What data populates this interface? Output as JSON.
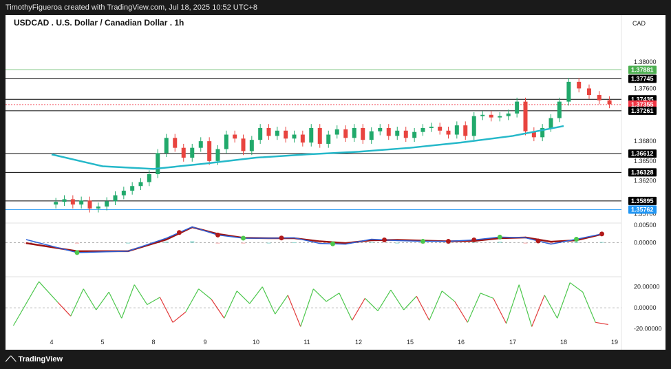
{
  "header": {
    "attribution": "TimothyFigueroa created with TradingView.com, Jul 18, 2025 10:52 UTC+8"
  },
  "footer": {
    "brand": "TradingView"
  },
  "colors": {
    "candle_up": "#21a96b",
    "candle_down": "#e8443f",
    "ma": "#25b8c9",
    "macd_line": "#2c62d8",
    "signal_line": "#9c1414",
    "osc_up": "#4cc74c",
    "osc_down": "#e23b3b",
    "tag_green": "#4caf50",
    "tag_red": "#f23645",
    "tag_blue": "#2196f3",
    "tag_black": "#000000"
  },
  "chart_data": [
    {
      "type": "candlestick",
      "title": "USDCAD . U.S. Dollar / Canadian Dollar . 1h",
      "currency": "CAD",
      "y_ticks": [
        "1.38000",
        "1.37600",
        "1.36800",
        "1.36500",
        "1.36200",
        "1.35900",
        "1.35700"
      ],
      "y_tick_values": [
        1.38,
        1.376,
        1.368,
        1.365,
        1.362,
        1.359,
        1.357
      ],
      "ylim": [
        1.3558,
        1.3821
      ],
      "x_ticks": [
        "4",
        "5",
        "8",
        "9",
        "10",
        "11",
        "12",
        "15",
        "16",
        "17",
        "18",
        "19"
      ],
      "horizontal_levels": [
        {
          "label": "1.37881",
          "value": 1.37881,
          "tag": "green"
        },
        {
          "label": "1.37745",
          "value": 1.37745,
          "tag": "black"
        },
        {
          "label": "1.37435",
          "value": 1.37435,
          "tag": "black"
        },
        {
          "label": "1.37355",
          "value": 1.37355,
          "tag": "red"
        },
        {
          "label": "1.37261",
          "value": 1.37261,
          "tag": "black"
        },
        {
          "label": "1.36612",
          "value": 1.36612,
          "tag": "black"
        },
        {
          "label": "1.36328",
          "value": 1.36328,
          "tag": "black"
        },
        {
          "label": "1.35895",
          "value": 1.35895,
          "tag": "black"
        },
        {
          "label": "1.35762",
          "value": 1.35762,
          "tag": "blue"
        }
      ],
      "close_series": [
        {
          "date": "4",
          "close": 1.3588
        },
        {
          "date": "4",
          "close": 1.3592
        },
        {
          "date": "4",
          "close": 1.3584
        },
        {
          "date": "4",
          "close": 1.359
        },
        {
          "date": "4",
          "close": 1.3578
        },
        {
          "date": "4",
          "close": 1.3581
        },
        {
          "date": "5",
          "close": 1.3589
        },
        {
          "date": "5",
          "close": 1.3598
        },
        {
          "date": "5",
          "close": 1.3605
        },
        {
          "date": "5",
          "close": 1.3612
        },
        {
          "date": "5",
          "close": 1.3618
        },
        {
          "date": "5",
          "close": 1.363
        },
        {
          "date": "8",
          "close": 1.3662
        },
        {
          "date": "8",
          "close": 1.3685
        },
        {
          "date": "8",
          "close": 1.367
        },
        {
          "date": "8",
          "close": 1.3655
        },
        {
          "date": "8",
          "close": 1.367
        },
        {
          "date": "8",
          "close": 1.368
        },
        {
          "date": "9",
          "close": 1.365
        },
        {
          "date": "9",
          "close": 1.3668
        },
        {
          "date": "9",
          "close": 1.369
        },
        {
          "date": "9",
          "close": 1.3684
        },
        {
          "date": "9",
          "close": 1.3665
        },
        {
          "date": "9",
          "close": 1.3682
        },
        {
          "date": "10",
          "close": 1.37
        },
        {
          "date": "10",
          "close": 1.3688
        },
        {
          "date": "10",
          "close": 1.3696
        },
        {
          "date": "10",
          "close": 1.3684
        },
        {
          "date": "10",
          "close": 1.369
        },
        {
          "date": "10",
          "close": 1.3678
        },
        {
          "date": "11",
          "close": 1.37
        },
        {
          "date": "11",
          "close": 1.3676
        },
        {
          "date": "11",
          "close": 1.369
        },
        {
          "date": "11",
          "close": 1.3698
        },
        {
          "date": "11",
          "close": 1.3685
        },
        {
          "date": "11",
          "close": 1.37
        },
        {
          "date": "12",
          "close": 1.3682
        },
        {
          "date": "12",
          "close": 1.3695
        },
        {
          "date": "12",
          "close": 1.37
        },
        {
          "date": "12",
          "close": 1.3688
        },
        {
          "date": "12",
          "close": 1.3696
        },
        {
          "date": "12",
          "close": 1.3685
        },
        {
          "date": "15",
          "close": 1.3694
        },
        {
          "date": "15",
          "close": 1.37
        },
        {
          "date": "15",
          "close": 1.3702
        },
        {
          "date": "15",
          "close": 1.3696
        },
        {
          "date": "15",
          "close": 1.369
        },
        {
          "date": "15",
          "close": 1.3704
        },
        {
          "date": "16",
          "close": 1.3688
        },
        {
          "date": "16",
          "close": 1.3718
        },
        {
          "date": "16",
          "close": 1.372
        },
        {
          "date": "16",
          "close": 1.3716
        },
        {
          "date": "16",
          "close": 1.3718
        },
        {
          "date": "16",
          "close": 1.3722
        },
        {
          "date": "17",
          "close": 1.374
        },
        {
          "date": "17",
          "close": 1.3695
        },
        {
          "date": "17",
          "close": 1.3686
        },
        {
          "date": "17",
          "close": 1.37
        },
        {
          "date": "17",
          "close": 1.3715
        },
        {
          "date": "17",
          "close": 1.374
        },
        {
          "date": "18",
          "close": 1.377
        },
        {
          "date": "18",
          "close": 1.376
        },
        {
          "date": "18",
          "close": 1.375
        },
        {
          "date": "18",
          "close": 1.3742
        },
        {
          "date": "18",
          "close": 1.3736
        }
      ],
      "moving_average": [
        {
          "date": "4",
          "value": 1.366
        },
        {
          "date": "5",
          "value": 1.3642
        },
        {
          "date": "8",
          "value": 1.3638
        },
        {
          "date": "9",
          "value": 1.3646
        },
        {
          "date": "10",
          "value": 1.3655
        },
        {
          "date": "11",
          "value": 1.366
        },
        {
          "date": "12",
          "value": 1.3664
        },
        {
          "date": "15",
          "value": 1.367
        },
        {
          "date": "16",
          "value": 1.3678
        },
        {
          "date": "17",
          "value": 1.3688
        },
        {
          "date": "18",
          "value": 1.3703
        }
      ]
    },
    {
      "type": "line",
      "name": "macd",
      "y_ticks": [
        "0.00500",
        "0.00000"
      ],
      "y_tick_values": [
        0.005,
        0.0
      ],
      "ylim": [
        -0.0034,
        0.0052
      ],
      "x_dates": [
        "3",
        "4",
        "5",
        "8",
        "8",
        "9",
        "9",
        "10",
        "10",
        "11",
        "11",
        "12",
        "12",
        "15",
        "15",
        "16",
        "16",
        "17",
        "17",
        "18",
        "18"
      ],
      "macd": [
        0.0009,
        -0.0028,
        -0.0024,
        0.0013,
        0.0045,
        0.0022,
        0.0013,
        0.0013,
        0.0014,
        -0.0002,
        -0.0004,
        0.001,
        0.0006,
        0.0004,
        0.0004,
        0.0008,
        0.0016,
        0.0014,
        -0.0004,
        0.001,
        0.0025
      ],
      "signal": [
        -0.0001,
        -0.0024,
        -0.0024,
        0.0009,
        0.0044,
        0.0025,
        0.0014,
        0.0013,
        0.0013,
        0.0004,
        -0.0001,
        0.0007,
        0.0008,
        0.0006,
        0.0004,
        0.0005,
        0.0013,
        0.0015,
        0.0003,
        0.0007,
        0.0024
      ],
      "histogram": [
        -0.0002,
        -0.0001,
        0.0,
        0.0003,
        0.0004,
        -0.0002,
        -0.0001,
        0.0,
        0.0001,
        -0.0003,
        -0.0002,
        0.0002,
        0.0,
        -0.0001,
        0.0,
        0.0002,
        0.0003,
        -0.0001,
        -0.0002,
        0.0003,
        0.0002
      ],
      "cross_markers": [
        {
          "date": "4",
          "kind": "bullish"
        },
        {
          "date": "8",
          "kind": "bearish"
        },
        {
          "date": "9",
          "kind": "bearish"
        },
        {
          "date": "9",
          "kind": "bullish"
        },
        {
          "date": "10",
          "kind": "bearish"
        },
        {
          "date": "11",
          "kind": "bullish"
        },
        {
          "date": "12",
          "kind": "bearish"
        },
        {
          "date": "15",
          "kind": "bullish"
        },
        {
          "date": "15",
          "kind": "bearish"
        },
        {
          "date": "16",
          "kind": "bearish"
        },
        {
          "date": "16",
          "kind": "bullish"
        },
        {
          "date": "17",
          "kind": "bearish"
        },
        {
          "date": "18",
          "kind": "bullish"
        },
        {
          "date": "18",
          "kind": "bearish"
        }
      ]
    },
    {
      "type": "line",
      "name": "oscillator",
      "y_ticks": [
        "20.00000",
        "0.00000",
        "-20.00000"
      ],
      "y_tick_values": [
        20,
        0,
        -20
      ],
      "ylim": [
        -23,
        27
      ],
      "dates": [
        "3",
        "3",
        "4",
        "4",
        "4",
        "4",
        "5",
        "5",
        "5",
        "5",
        "8",
        "8",
        "8",
        "8",
        "9",
        "9",
        "9",
        "9",
        "10",
        "10",
        "10",
        "10",
        "11",
        "11",
        "11",
        "11",
        "12",
        "12",
        "12",
        "12",
        "15",
        "15",
        "15",
        "15",
        "16",
        "16",
        "16",
        "16",
        "17",
        "17",
        "17",
        "17",
        "18",
        "18",
        "18",
        "18"
      ],
      "values": [
        -17,
        25,
        5,
        -8,
        18,
        -2,
        15,
        -10,
        22,
        3,
        10,
        -14,
        -4,
        18,
        8,
        -10,
        16,
        4,
        20,
        -6,
        12,
        -18,
        18,
        6,
        14,
        -12,
        9,
        -3,
        17,
        -2,
        11,
        -12,
        16,
        6,
        -14,
        14,
        9,
        -15,
        22,
        -18,
        12,
        -10,
        24,
        15,
        -14,
        -16
      ]
    }
  ]
}
